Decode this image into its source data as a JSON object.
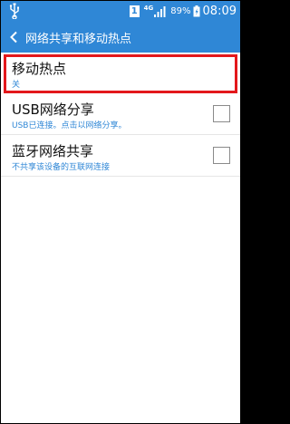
{
  "status_bar": {
    "usb_icon": "usb-icon",
    "sim_label": "1",
    "network_type": "4G",
    "signal_icon": "signal-bars-icon",
    "battery_percent": "89%",
    "battery_icon": "battery-charging-icon",
    "time": "08:09"
  },
  "header": {
    "back_icon": "chevron-left-icon",
    "title": "网络共享和移动热点"
  },
  "settings": {
    "items": [
      {
        "title": "移动热点",
        "subtitle": "关",
        "has_checkbox": false,
        "selected": true
      },
      {
        "title": "USB网络分享",
        "subtitle": "USB已连接。点击以网络分享。",
        "has_checkbox": true,
        "checked": false
      },
      {
        "title": "蓝牙网络共享",
        "subtitle": "不共享该设备的互联网连接",
        "has_checkbox": true,
        "checked": false
      }
    ]
  },
  "colors": {
    "accent": "#2f87d6",
    "highlight": "#e3171b"
  }
}
